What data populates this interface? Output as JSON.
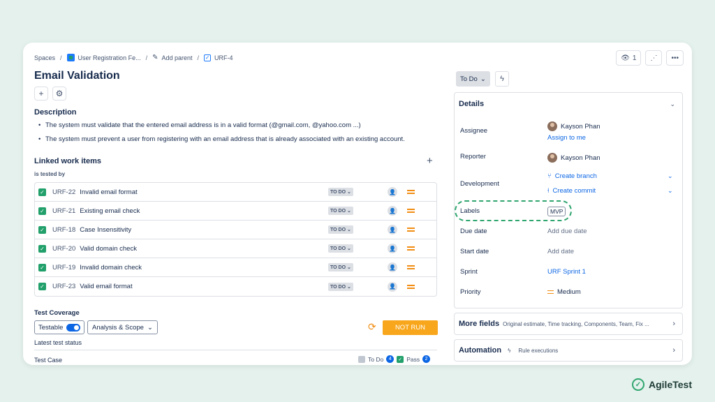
{
  "breadcrumb": {
    "spaces": "Spaces",
    "project": "User Registration Fe...",
    "add_parent": "Add parent",
    "issue_key": "URF-4"
  },
  "top_actions": {
    "watchers": "1"
  },
  "title": "Email Validation",
  "description": {
    "heading": "Description",
    "bullets": [
      "The system must validate that the entered email address is in a valid format (@gmail.com, @yahoo.com ...)",
      "The system must prevent a user from registering with an email address that is already associated with an existing account."
    ]
  },
  "linked": {
    "heading": "Linked work items",
    "relation": "is tested by",
    "items": [
      {
        "key": "URF-22",
        "summary": "Invalid email format",
        "status": "TO DO"
      },
      {
        "key": "URF-21",
        "summary": "Existing email check",
        "status": "TO DO"
      },
      {
        "key": "URF-18",
        "summary": "Case Insensitivity",
        "status": "TO DO"
      },
      {
        "key": "URF-20",
        "summary": "Valid domain check",
        "status": "TO DO"
      },
      {
        "key": "URF-19",
        "summary": "Invalid domain check",
        "status": "TO DO"
      },
      {
        "key": "URF-23",
        "summary": "Valid email format",
        "status": "TO DO"
      }
    ]
  },
  "coverage": {
    "heading": "Test Coverage",
    "testable": "Testable",
    "analysis": "Analysis & Scope",
    "not_run": "NOT RUN",
    "latest": "Latest test status",
    "test_case": "Test Case",
    "todo_label": "To Do",
    "todo_count": "4",
    "pass_label": "Pass",
    "pass_count": "2"
  },
  "status_button": "To Do",
  "details": {
    "heading": "Details",
    "assignee_label": "Assignee",
    "assignee": "Kayson Phan",
    "assign_to_me": "Assign to me",
    "reporter_label": "Reporter",
    "reporter": "Kayson Phan",
    "development_label": "Development",
    "create_branch": "Create branch",
    "create_commit": "Create commit",
    "labels_label": "Labels",
    "label_value": "MVP",
    "due_label": "Due date",
    "due_value": "Add due date",
    "start_label": "Start date",
    "start_value": "Add date",
    "sprint_label": "Sprint",
    "sprint_value": "URF Sprint 1",
    "priority_label": "Priority",
    "priority_value": "Medium"
  },
  "more_fields": {
    "title": "More fields",
    "subtitle": "Original estimate, Time tracking, Components, Team, Fix ..."
  },
  "automation": {
    "title": "Automation",
    "subtitle": "Rule executions"
  },
  "brand": "AgileTest",
  "colors": {
    "accent": "#0c66e4",
    "not_run": "#f8a61b",
    "success": "#22a06b",
    "background": "#e4f1ec"
  }
}
